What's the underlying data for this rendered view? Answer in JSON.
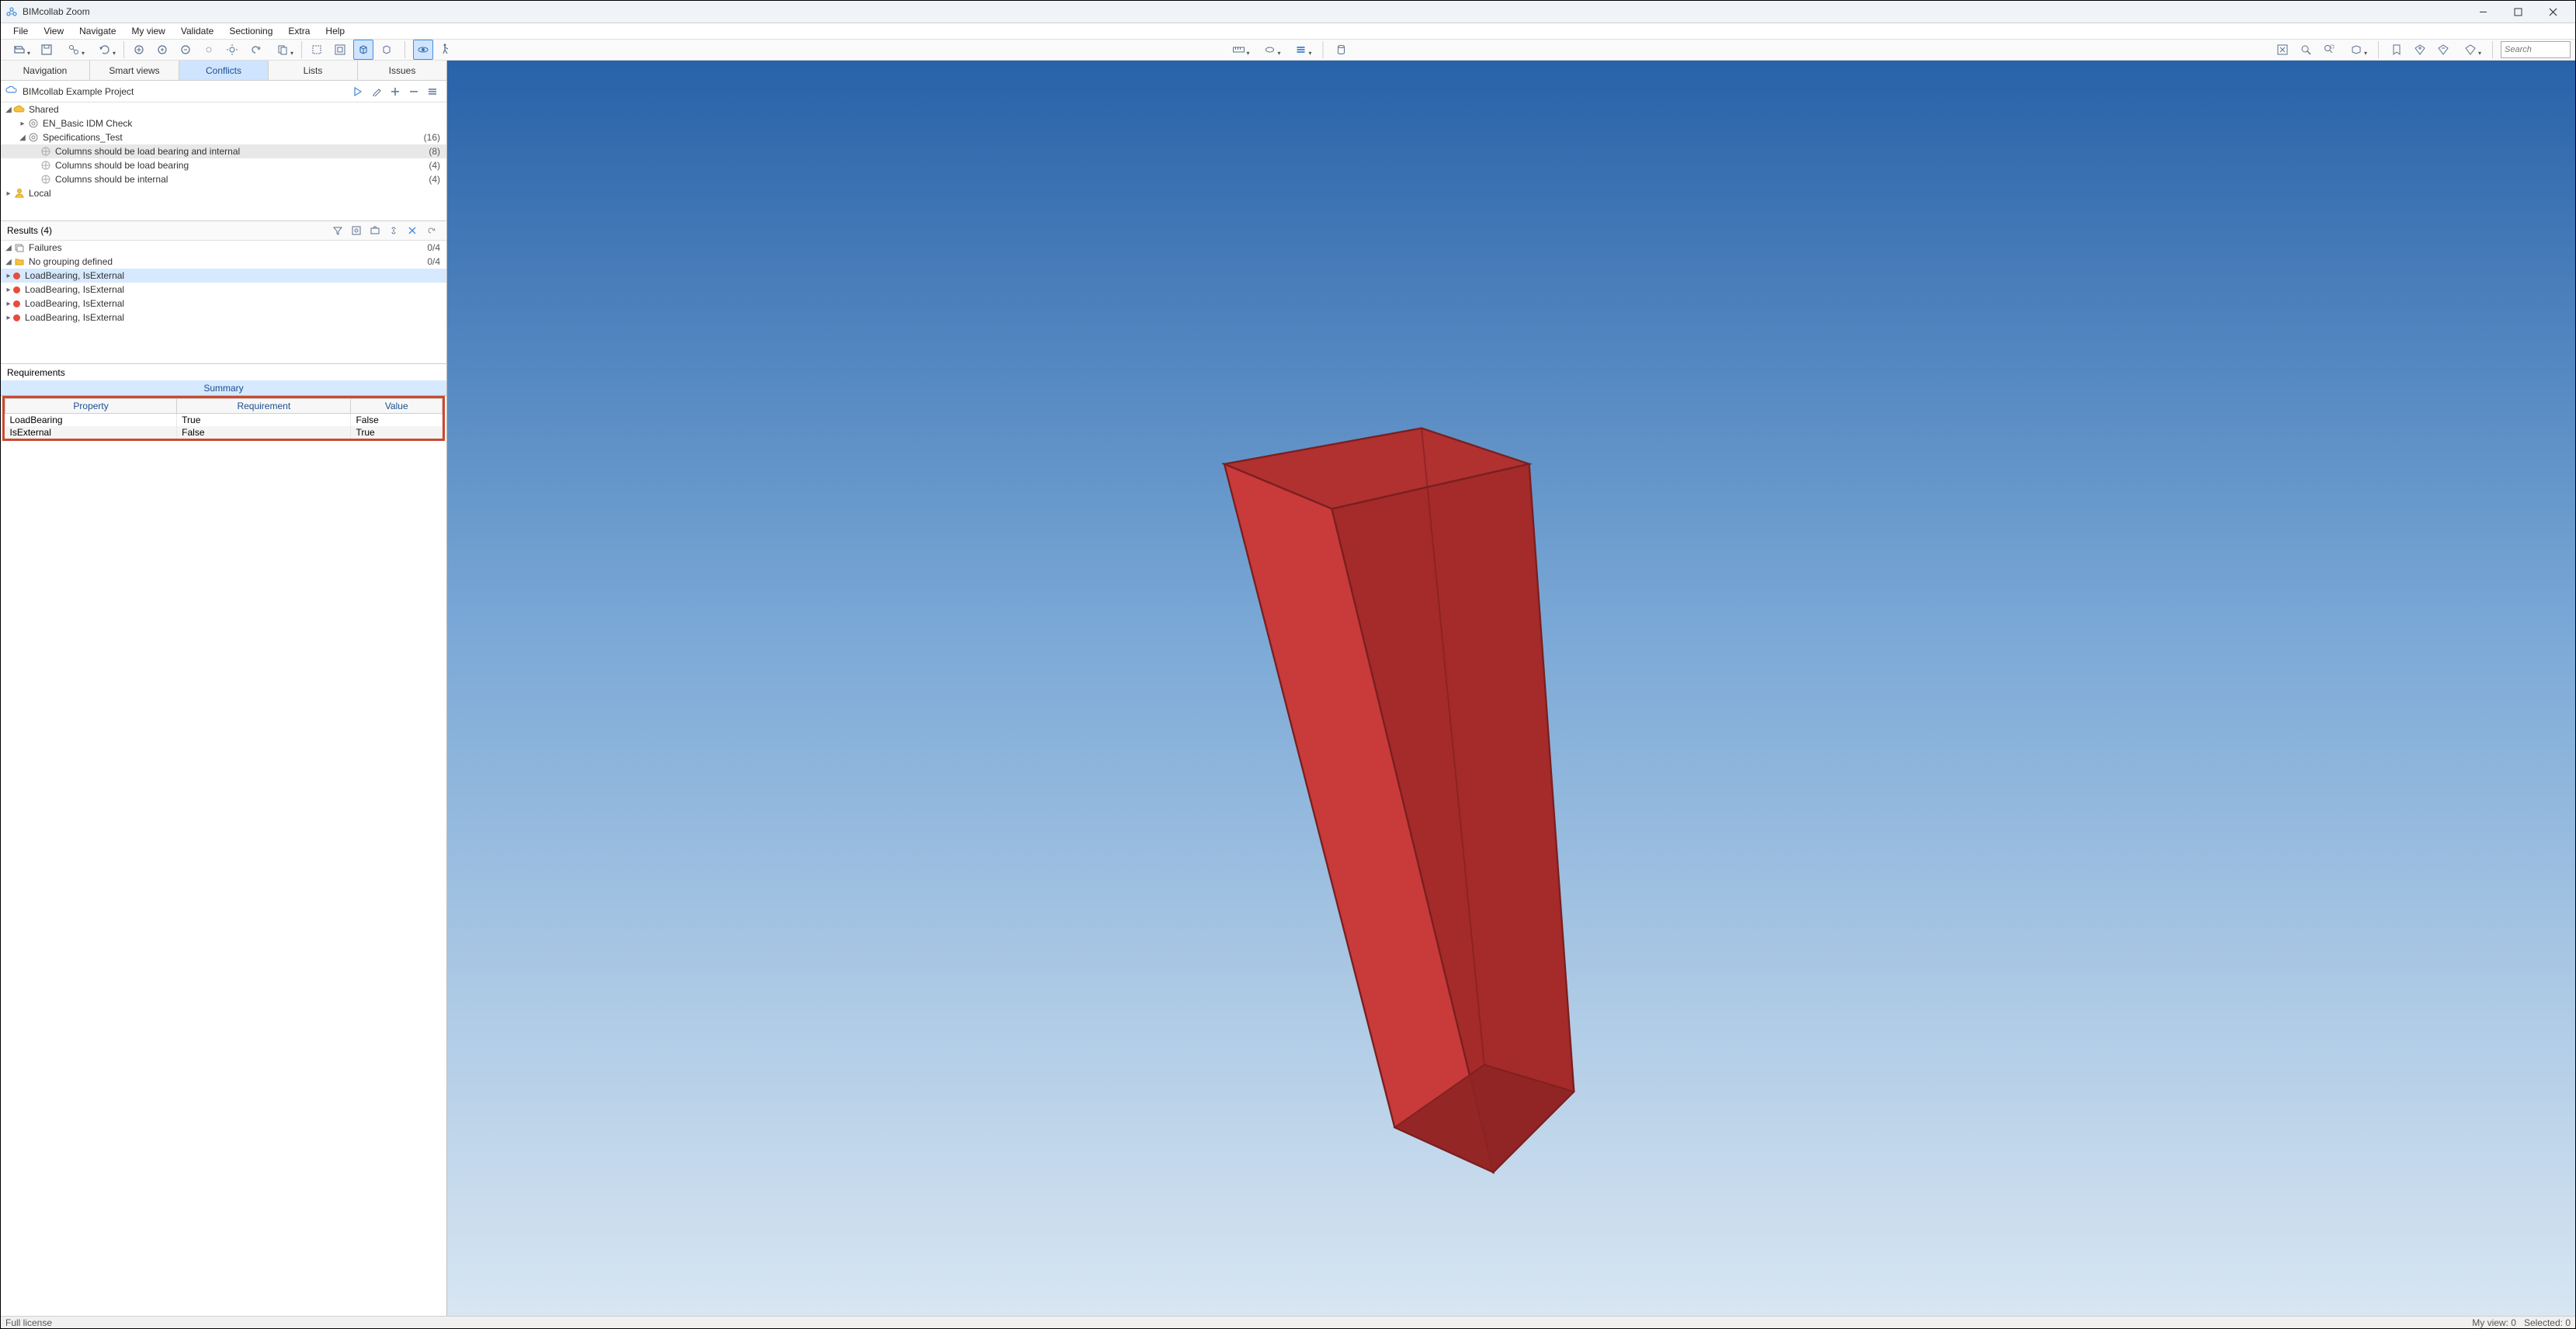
{
  "window": {
    "title": "BIMcollab Zoom"
  },
  "menu": {
    "items": [
      "File",
      "View",
      "Navigate",
      "My view",
      "Validate",
      "Sectioning",
      "Extra",
      "Help"
    ]
  },
  "search": {
    "placeholder": "Search"
  },
  "panel_tabs": [
    "Navigation",
    "Smart views",
    "Conflicts",
    "Lists",
    "Issues"
  ],
  "panel_tabs_active": 2,
  "project": {
    "name": "BIMcollab Example Project"
  },
  "tree": {
    "shared": "Shared",
    "local": "Local",
    "idm": "EN_Basic IDM Check",
    "spec": {
      "label": "Specifications_Test",
      "count": "(16)"
    },
    "spec_children": [
      {
        "label": "Columns should be load bearing and internal",
        "count": "(8)"
      },
      {
        "label": "Columns should be load bearing",
        "count": "(4)"
      },
      {
        "label": "Columns should be internal",
        "count": "(4)"
      }
    ]
  },
  "results": {
    "header": "Results (4)",
    "failures": {
      "label": "Failures",
      "count": "0/4"
    },
    "nogroup": {
      "label": "No grouping defined",
      "count": "0/4"
    },
    "items": [
      "LoadBearing, IsExternal",
      "LoadBearing, IsExternal",
      "LoadBearing, IsExternal",
      "LoadBearing, IsExternal"
    ]
  },
  "requirements": {
    "header": "Requirements",
    "summary": "Summary",
    "columns": [
      "Property",
      "Requirement",
      "Value"
    ],
    "rows": [
      {
        "property": "LoadBearing",
        "requirement": "True",
        "value": "False"
      },
      {
        "property": "IsExternal",
        "requirement": "False",
        "value": "True"
      }
    ]
  },
  "status": {
    "license": "Full license",
    "myview": "My view: 0",
    "selected": "Selected: 0"
  }
}
